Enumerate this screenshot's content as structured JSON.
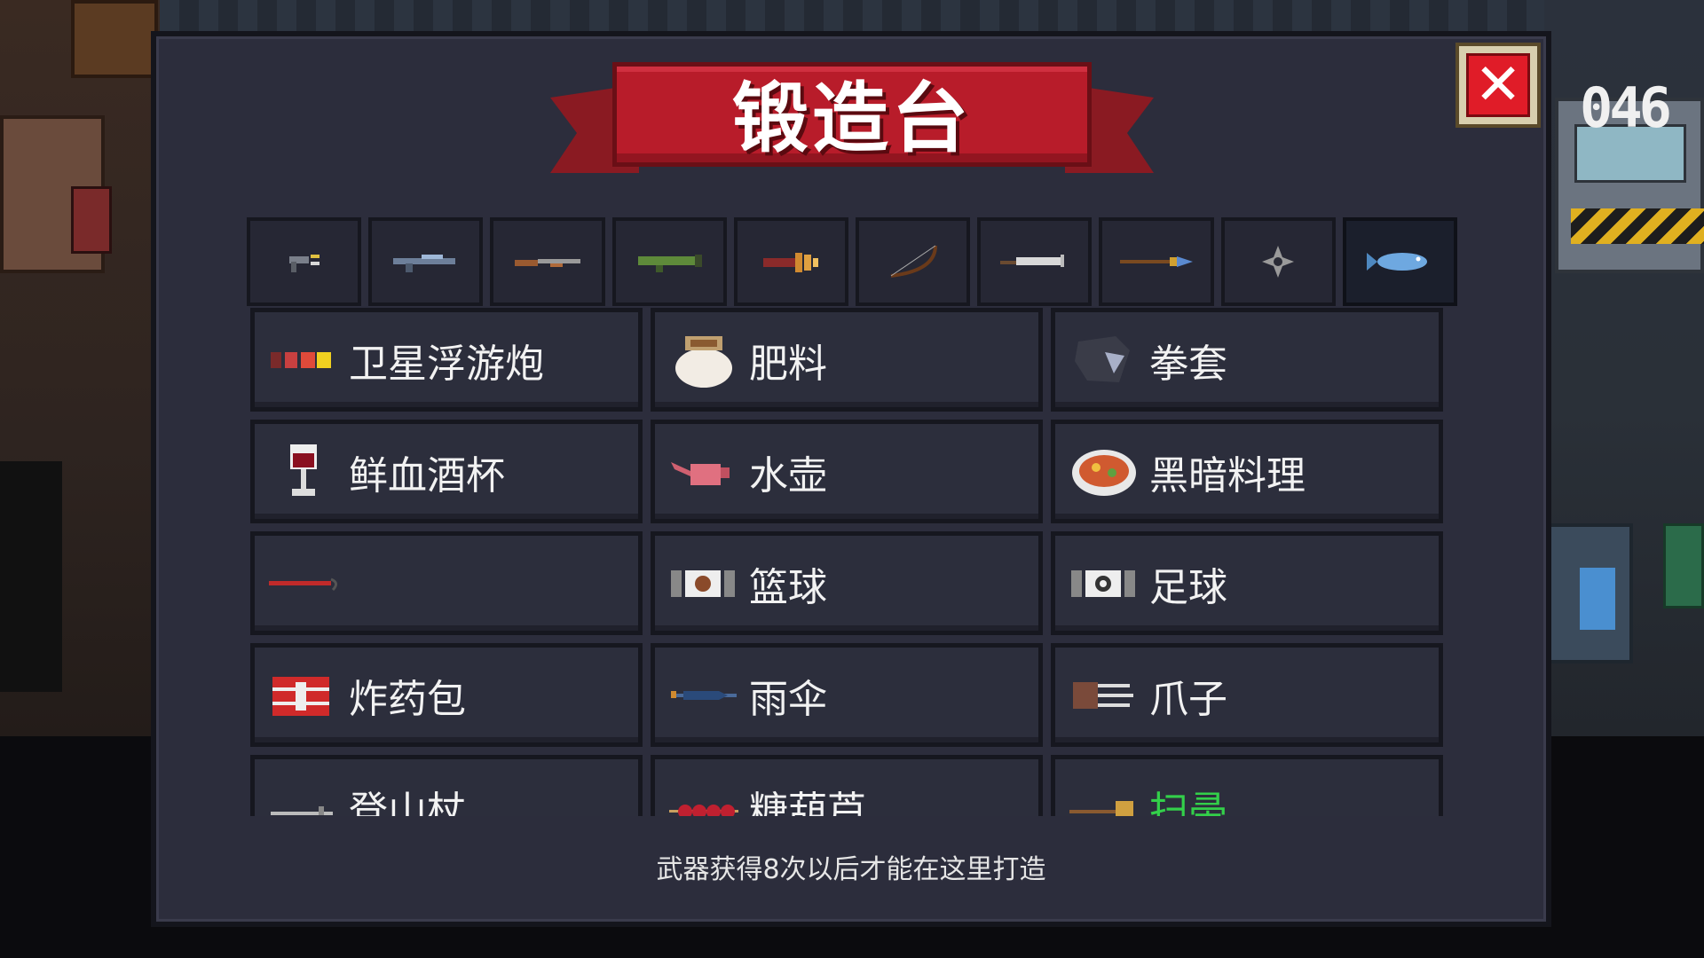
{
  "title": "锻造台",
  "close_icon": "close-x-icon",
  "counter_text": "046",
  "tabs": [
    {
      "icon": "pistol-icon",
      "active": false
    },
    {
      "icon": "rifle-icon",
      "active": false
    },
    {
      "icon": "shotgun-icon",
      "active": false
    },
    {
      "icon": "rocket-launcher-icon",
      "active": false
    },
    {
      "icon": "staff-gun-icon",
      "active": false
    },
    {
      "icon": "bow-icon",
      "active": false
    },
    {
      "icon": "sword-icon",
      "active": false
    },
    {
      "icon": "spear-icon",
      "active": false
    },
    {
      "icon": "shuriken-icon",
      "active": false
    },
    {
      "icon": "fish-icon",
      "active": true
    }
  ],
  "items": [
    {
      "label": "卫星浮游炮",
      "icon": "satellite-cannon-icon"
    },
    {
      "label": "肥料",
      "icon": "fertilizer-bag-icon"
    },
    {
      "label": "拳套",
      "icon": "gauntlet-icon"
    },
    {
      "label": "鲜血酒杯",
      "icon": "blood-goblet-icon"
    },
    {
      "label": "水壶",
      "icon": "watering-can-icon"
    },
    {
      "label": "黑暗料理",
      "icon": "dark-cuisine-icon"
    },
    {
      "label": "",
      "icon": "red-hook-icon"
    },
    {
      "label": "篮球",
      "icon": "basketball-box-icon"
    },
    {
      "label": "足球",
      "icon": "football-box-icon"
    },
    {
      "label": "炸药包",
      "icon": "dynamite-icon"
    },
    {
      "label": "雨伞",
      "icon": "umbrella-icon"
    },
    {
      "label": "爪子",
      "icon": "claw-icon"
    },
    {
      "label": "登山杖",
      "icon": "walking-stick-icon"
    },
    {
      "label": "糖葫芦",
      "icon": "candied-haws-icon"
    },
    {
      "label": "扫帚",
      "icon": "broom-icon",
      "label_color": "#33d04a"
    }
  ],
  "hint": "武器获得8次以后才能在这里打造"
}
